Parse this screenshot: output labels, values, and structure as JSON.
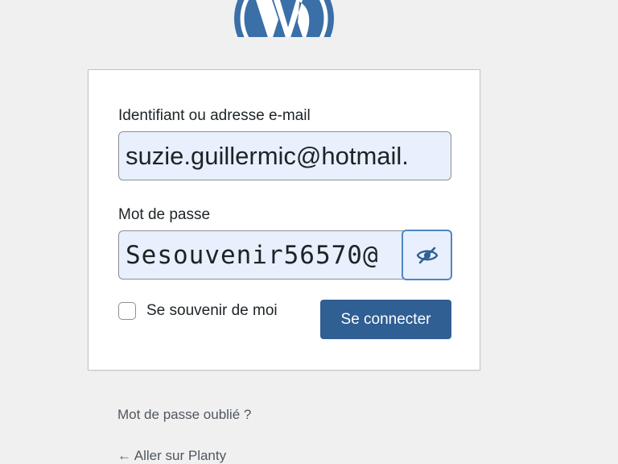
{
  "logo": {
    "icon": "wordpress-logo-icon",
    "color": "#3a6fa8"
  },
  "login_form": {
    "username_label": "Identifiant ou adresse e-mail",
    "username_value": "suzie.guillermic@hotmail.",
    "password_label": "Mot de passe",
    "password_value": "Sesouvenir56570@",
    "toggle_password_icon": "eye-slash-icon",
    "remember_label": "Se souvenir de moi",
    "remember_checked": false,
    "submit_label": "Se connecter"
  },
  "links": {
    "lost_password": "Mot de passe oublié ?",
    "back_to_site": "← Aller sur Planty"
  },
  "colors": {
    "background": "#f0f0f1",
    "button": "#2f5f93",
    "input_fill": "#e8f0fe",
    "focus_border": "#4f86c6"
  }
}
